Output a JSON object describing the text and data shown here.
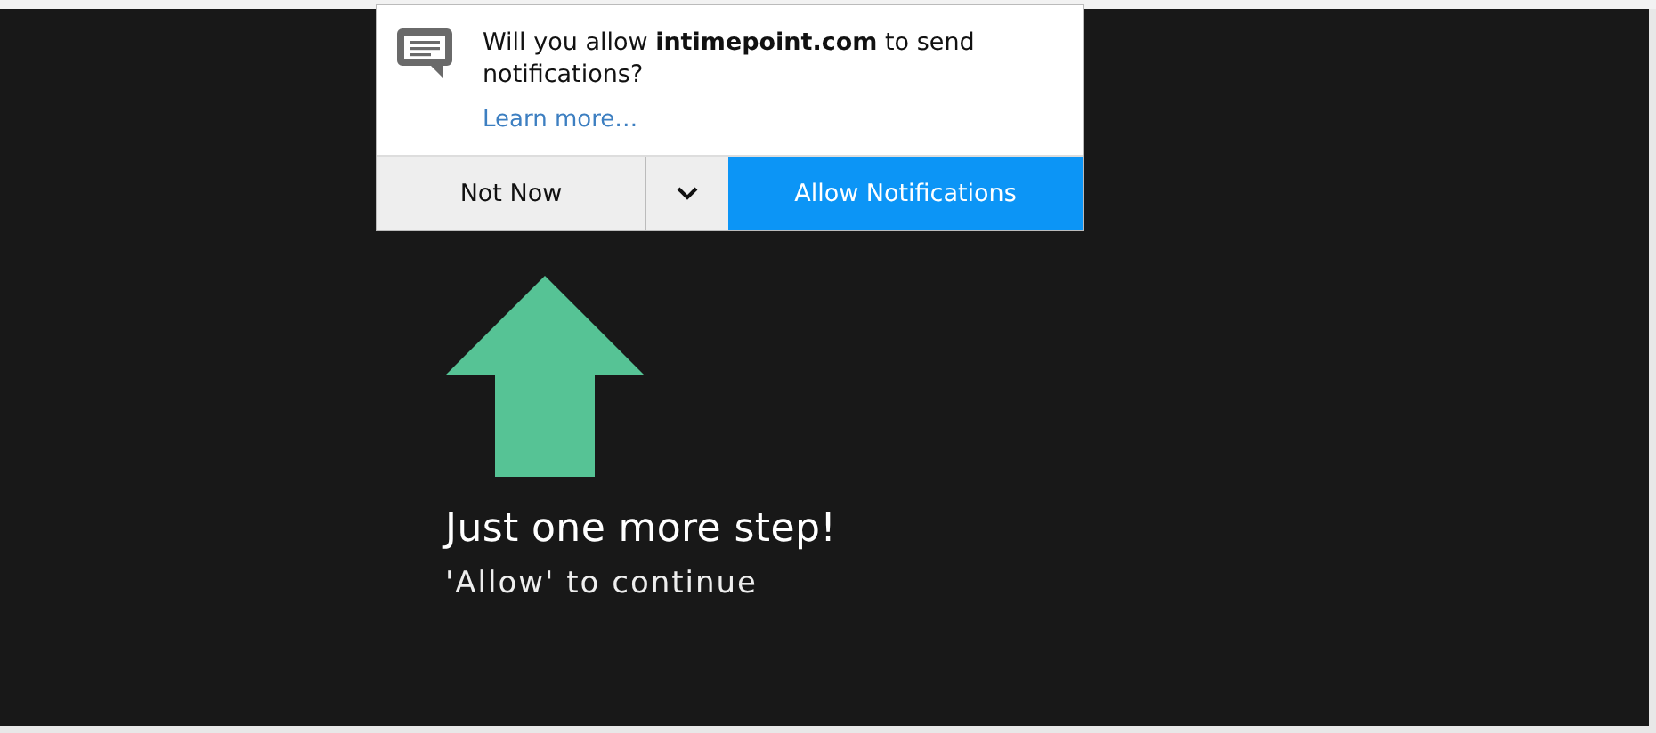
{
  "prompt": {
    "message": "Will you allow **intimepoint.com** to send notifications?",
    "link": "Learn more…",
    "buttons": [
      {
        "label": "Not Now",
        "kind": "secondary"
      },
      {
        "label": "Allow Notifications",
        "kind": "primary"
      }
    ]
  },
  "page": {
    "heading": "Just one more step!",
    "subheading": "'Allow' to continue"
  }
}
